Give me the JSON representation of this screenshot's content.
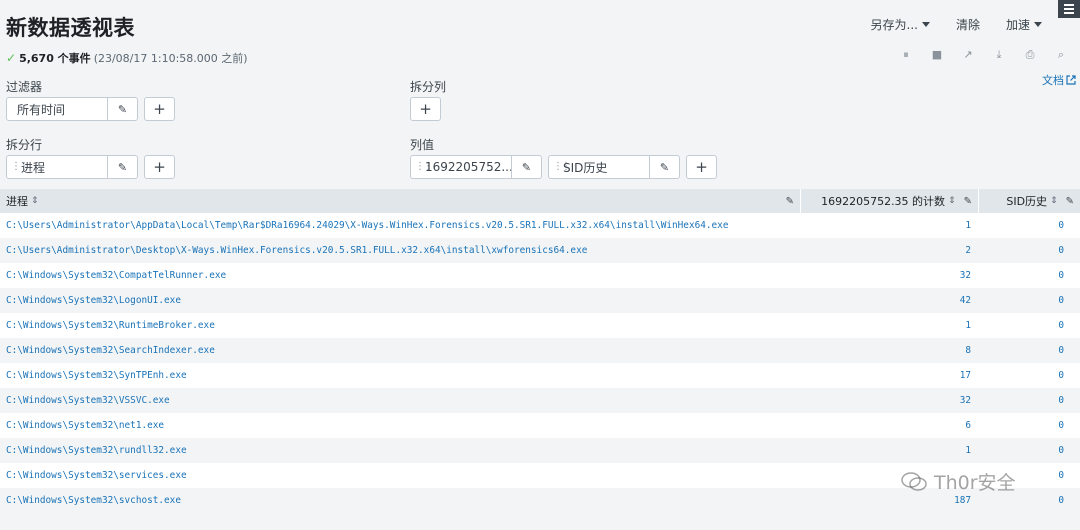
{
  "header": {
    "title": "新数据透视表",
    "save_as": "另存为...",
    "clear": "清除",
    "accelerate": "加速"
  },
  "status": {
    "check": "✓",
    "count": "5,670 个事件",
    "time": "(23/08/17 1:10:58.000 之前)"
  },
  "toolbar": {
    "pause": "⏸",
    "stop": "■",
    "share": "↗",
    "export": "⤓",
    "print": "⎙",
    "search": "⌕"
  },
  "doc_link": "文档",
  "config": {
    "filters_label": "过滤器",
    "filter_value": "所有时间",
    "split_cols_label": "拆分列",
    "split_rows_label": "拆分行",
    "split_row_value": "进程",
    "col_values_label": "列值",
    "col_value_1": "1692205752....",
    "col_value_2": "SID历史"
  },
  "table": {
    "headers": {
      "process": "进程",
      "count": "1692205752.35 的计数",
      "sid": "SID历史"
    },
    "rows": [
      {
        "process": "C:\\Users\\Administrator\\AppData\\Local\\Temp\\Rar$DRa16964.24029\\X-Ways.WinHex.Forensics.v20.5.SR1.FULL.x32.x64\\install\\WinHex64.exe",
        "count": "1",
        "sid": "0"
      },
      {
        "process": "C:\\Users\\Administrator\\Desktop\\X-Ways.WinHex.Forensics.v20.5.SR1.FULL.x32.x64\\install\\xwforensics64.exe",
        "count": "2",
        "sid": "0"
      },
      {
        "process": "C:\\Windows\\System32\\CompatTelRunner.exe",
        "count": "32",
        "sid": "0"
      },
      {
        "process": "C:\\Windows\\System32\\LogonUI.exe",
        "count": "42",
        "sid": "0"
      },
      {
        "process": "C:\\Windows\\System32\\RuntimeBroker.exe",
        "count": "1",
        "sid": "0"
      },
      {
        "process": "C:\\Windows\\System32\\SearchIndexer.exe",
        "count": "8",
        "sid": "0"
      },
      {
        "process": "C:\\Windows\\System32\\SynTPEnh.exe",
        "count": "17",
        "sid": "0"
      },
      {
        "process": "C:\\Windows\\System32\\VSSVC.exe",
        "count": "32",
        "sid": "0"
      },
      {
        "process": "C:\\Windows\\System32\\net1.exe",
        "count": "6",
        "sid": "0"
      },
      {
        "process": "C:\\Windows\\System32\\rundll32.exe",
        "count": "1",
        "sid": "0"
      },
      {
        "process": "C:\\Windows\\System32\\services.exe",
        "count": "",
        "sid": "0"
      },
      {
        "process": "C:\\Windows\\System32\\svchost.exe",
        "count": "187",
        "sid": "0"
      }
    ]
  },
  "watermark": "Th0r安全"
}
